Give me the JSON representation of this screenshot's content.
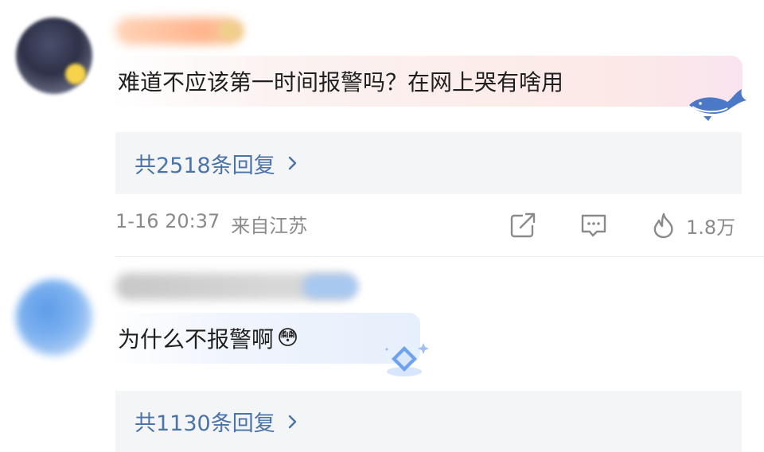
{
  "comments": [
    {
      "text": "难道不应该第一时间报警吗？在网上哭有啥用",
      "replies_label": "共2518条回复",
      "date": "1-16 20:37",
      "location": "来自江苏",
      "likes": "1.8万"
    },
    {
      "text": "为什么不报警啊",
      "emoji": "😳",
      "replies_label": "共1130条回复"
    }
  ],
  "colors": {
    "reply_link": "#4a73a8",
    "meta_gray": "#8a8a8a",
    "reply_bg": "#f4f5f7"
  },
  "icons": [
    "share-icon",
    "comment-icon",
    "fire-like-icon",
    "chevron-right-icon",
    "whale-decoration-icon",
    "diamond-decoration-icon"
  ]
}
